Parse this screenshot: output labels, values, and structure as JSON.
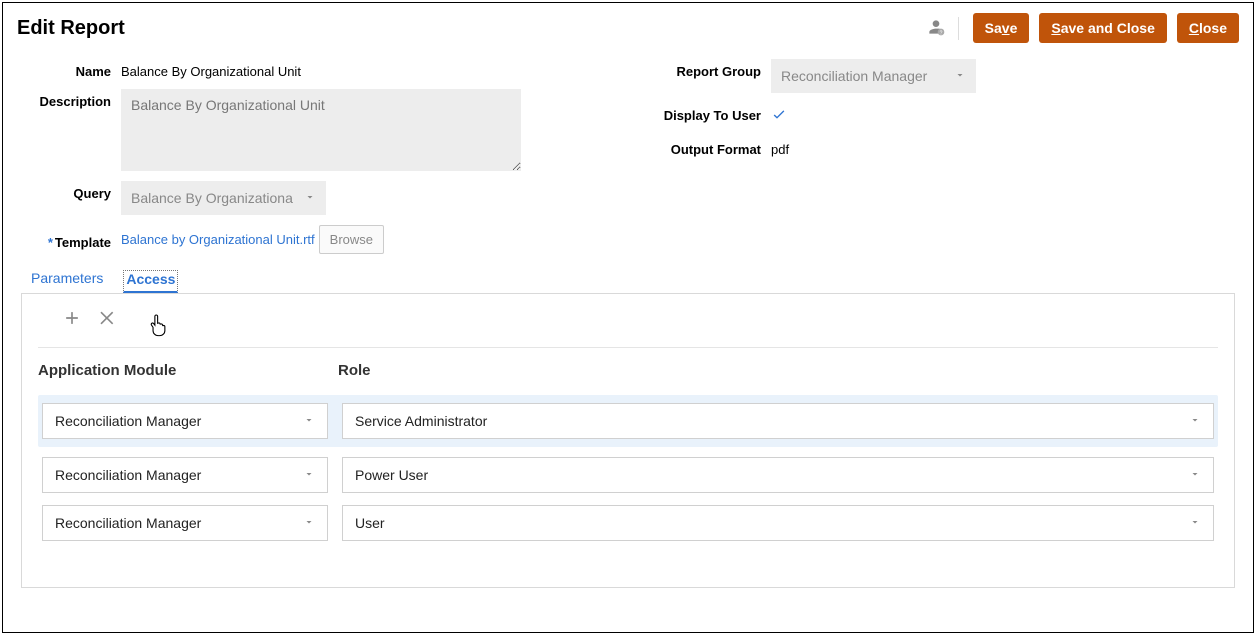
{
  "header": {
    "title": "Edit Report",
    "buttons": {
      "save": "Save",
      "save_close": "Save and Close",
      "close": "Close"
    }
  },
  "form": {
    "name_label": "Name",
    "name_value": "Balance By Organizational Unit",
    "description_label": "Description",
    "description_value": "Balance By Organizational Unit",
    "query_label": "Query",
    "query_value": "Balance By Organizationa",
    "template_label": "Template",
    "template_value": "Balance by Organizational Unit.rtf",
    "browse_label": "Browse",
    "report_group_label": "Report Group",
    "report_group_value": "Reconciliation Manager",
    "display_to_user_label": "Display To User",
    "output_format_label": "Output Format",
    "output_format_value": "pdf"
  },
  "tabs": {
    "parameters": "Parameters",
    "access": "Access"
  },
  "access": {
    "columns": {
      "app_module": "Application Module",
      "role": "Role"
    },
    "rows": [
      {
        "app_module": "Reconciliation Manager",
        "role": "Service Administrator"
      },
      {
        "app_module": "Reconciliation Manager",
        "role": "Power User"
      },
      {
        "app_module": "Reconciliation Manager",
        "role": "User"
      }
    ]
  }
}
